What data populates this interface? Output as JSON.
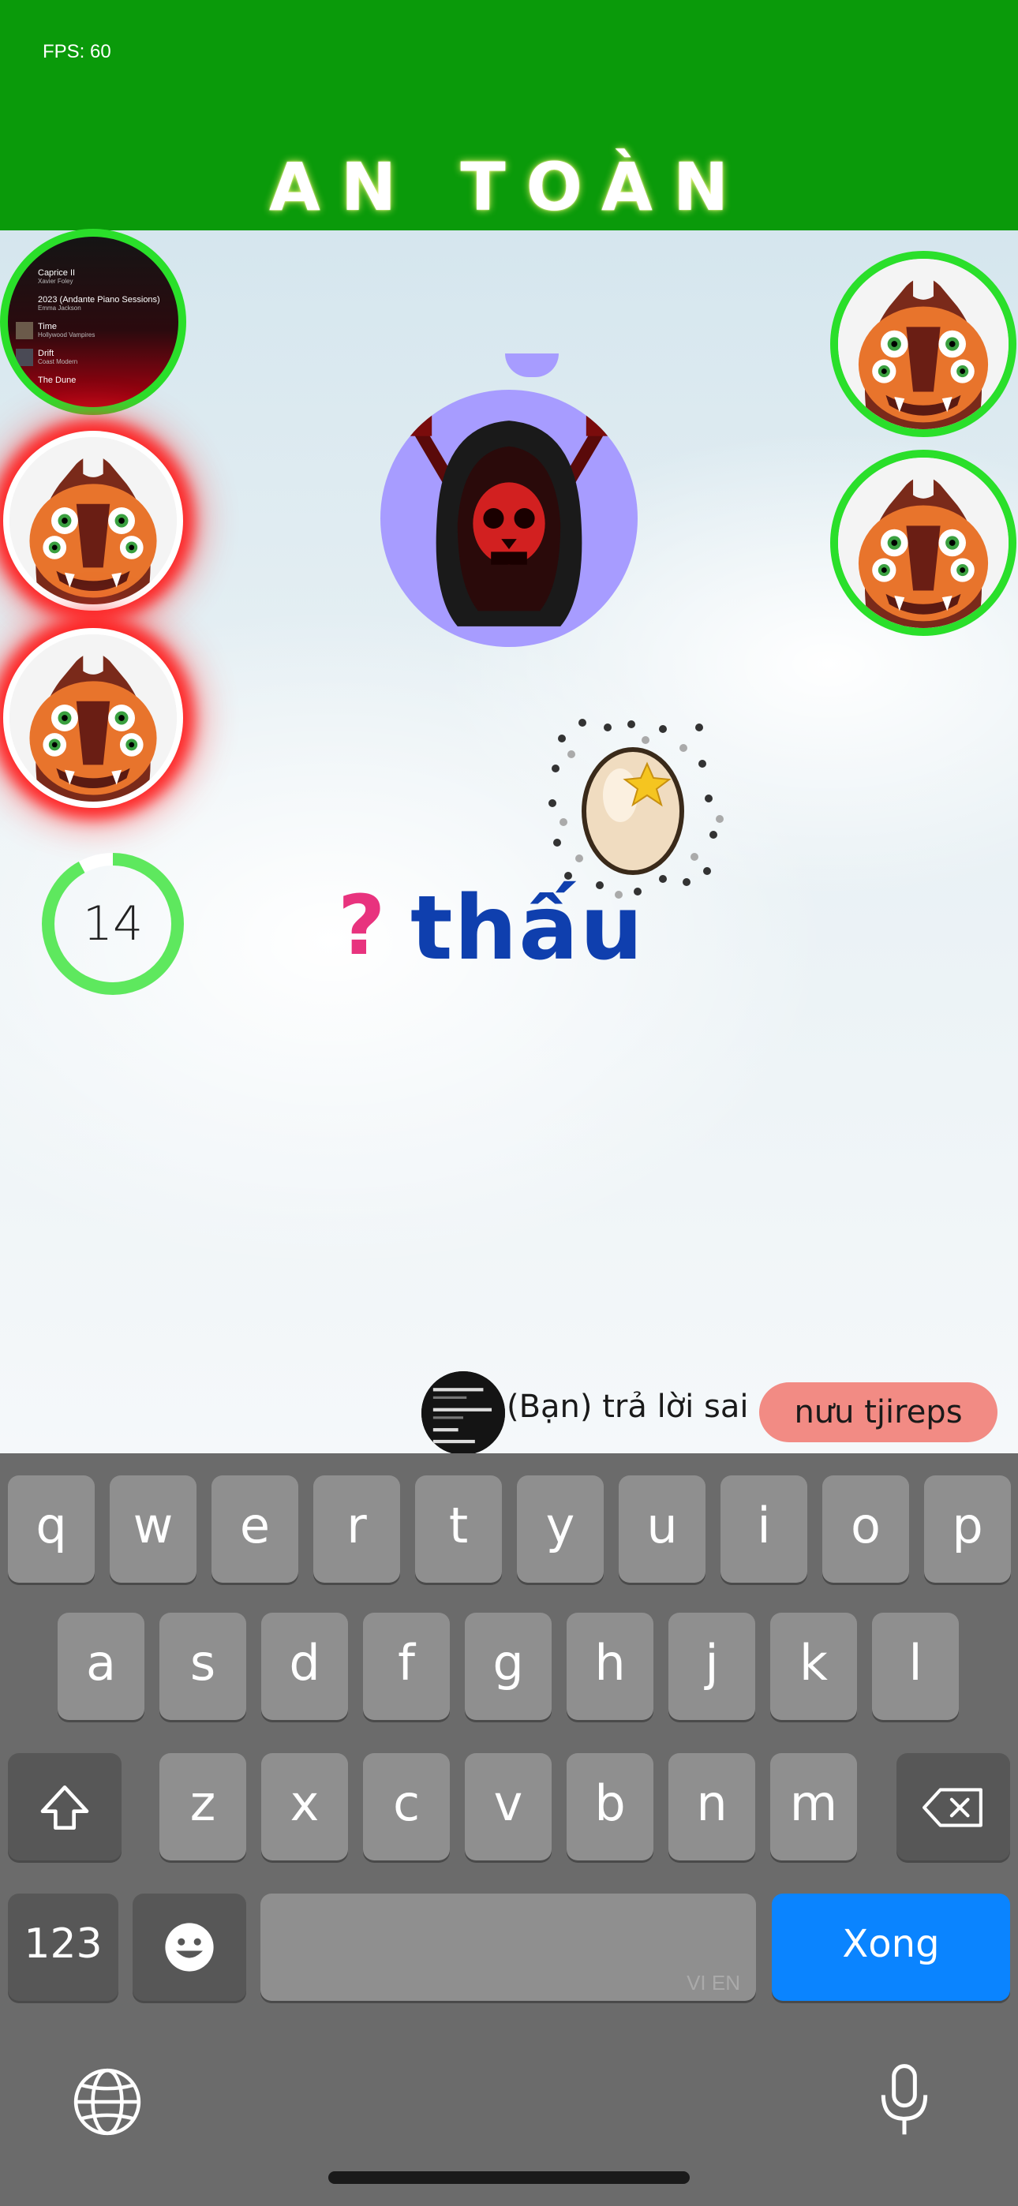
{
  "header": {
    "fps": "FPS: 60",
    "title": "AN TOÀN",
    "background_color": "#0a9a0a"
  },
  "playlist_avatar": {
    "rows": [
      {
        "title": "Caprice II",
        "subtitle": "Xavier Foley"
      },
      {
        "title": "2023 (Andante Piano Sessions)",
        "subtitle": "Emma Jackson"
      },
      {
        "title": "Time",
        "subtitle": "Hollywood Vampires"
      },
      {
        "title": "Drift",
        "subtitle": "Coast Modern"
      },
      {
        "title": "The Dune",
        "subtitle": ""
      }
    ]
  },
  "players": {
    "left": [
      {
        "status": "safe",
        "border_color": "#2adf2a",
        "icon": "playlist-avatar"
      },
      {
        "status": "danger",
        "glow_color": "#ff1414",
        "icon": "monster-face-icon"
      },
      {
        "status": "danger",
        "glow_color": "#ff1414",
        "icon": "monster-face-icon"
      }
    ],
    "right": [
      {
        "status": "safe",
        "border_color": "#2adf2a",
        "icon": "monster-face-icon"
      },
      {
        "status": "safe",
        "border_color": "#2adf2a",
        "icon": "monster-face-icon"
      }
    ]
  },
  "boss": {
    "icon": "hooded-skull-icon",
    "color": "#a79cff"
  },
  "timer": {
    "value": "14",
    "progress": 0.92,
    "color": "#5ee85e"
  },
  "prompt": {
    "question_mark": "?",
    "word": "thấu",
    "question_color": "#e8337e",
    "word_color": "#0f3fae"
  },
  "item": {
    "icon": "star-egg-icon"
  },
  "answer": {
    "text": "(Bạn) trả lời sai",
    "input": "nưu tjireps",
    "pill_color": "#f28b84"
  },
  "keyboard": {
    "row1": [
      "q",
      "w",
      "e",
      "r",
      "t",
      "y",
      "u",
      "i",
      "o",
      "p"
    ],
    "row2": [
      "a",
      "s",
      "d",
      "f",
      "g",
      "h",
      "j",
      "k",
      "l"
    ],
    "row3": [
      "z",
      "x",
      "c",
      "v",
      "b",
      "n",
      "m"
    ],
    "numbers_label": "123",
    "space_hint": "VI EN",
    "done_label": "Xong",
    "done_color": "#0a84ff",
    "icons": [
      "shift-icon",
      "backspace-icon",
      "emoji-icon",
      "globe-icon",
      "microphone-icon"
    ]
  }
}
